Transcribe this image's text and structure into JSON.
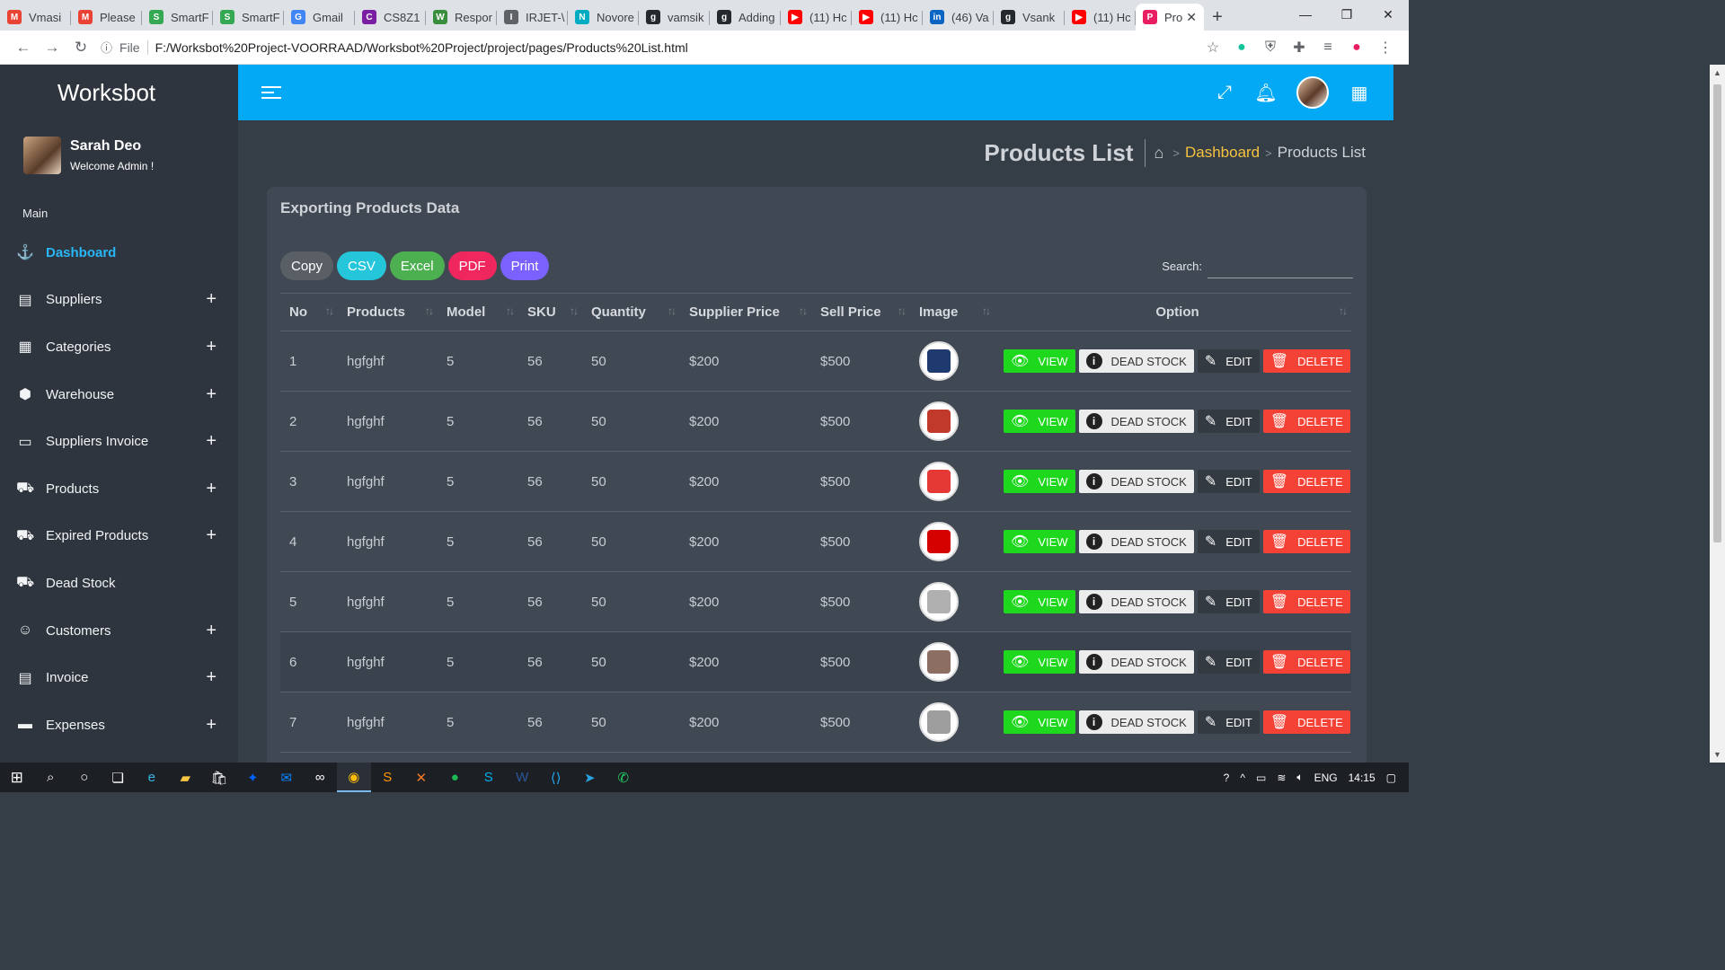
{
  "browser": {
    "tabs": [
      {
        "label": "Vmasi",
        "color": "#ea4335",
        "glyph": "M"
      },
      {
        "label": "Please",
        "color": "#ea4335",
        "glyph": "M"
      },
      {
        "label": "SmartF",
        "color": "#34a853",
        "glyph": "S"
      },
      {
        "label": "SmartF",
        "color": "#34a853",
        "glyph": "S"
      },
      {
        "label": "Gmail",
        "color": "#4285f4",
        "glyph": "G"
      },
      {
        "label": "CS8Z1",
        "color": "#7b1fa2",
        "glyph": "C"
      },
      {
        "label": "Respor",
        "color": "#388e3c",
        "glyph": "W"
      },
      {
        "label": "IRJET-\\",
        "color": "#5f6368",
        "glyph": "I"
      },
      {
        "label": "Novore",
        "color": "#00acc1",
        "glyph": "N"
      },
      {
        "label": "vamsik",
        "color": "#24292e",
        "glyph": "g"
      },
      {
        "label": "Adding",
        "color": "#24292e",
        "glyph": "g"
      },
      {
        "label": "(11) Hc",
        "color": "#ff0000",
        "glyph": "▶"
      },
      {
        "label": "(11) Hc",
        "color": "#ff0000",
        "glyph": "▶"
      },
      {
        "label": "(46) Va",
        "color": "#0a66c2",
        "glyph": "in"
      },
      {
        "label": "Vsank",
        "color": "#24292e",
        "glyph": "g"
      },
      {
        "label": "(11) Hc",
        "color": "#ff0000",
        "glyph": "▶"
      }
    ],
    "active_tab": {
      "label": "Pro",
      "color": "#e91e63",
      "glyph": "P"
    },
    "url_prefix": "File",
    "url": "F:/Worksbot%20Project-VOORRAAD/Worksbot%20Project/project/pages/Products%20List.html"
  },
  "sidebar": {
    "brand": "Worksbot",
    "user_name": "Sarah Deo",
    "user_role": "Welcome Admin !",
    "section": "Main",
    "items": [
      {
        "label": "Dashboard",
        "icon": "⚓",
        "active": true,
        "expand": ""
      },
      {
        "label": "Suppliers",
        "icon": "▤",
        "active": false,
        "expand": "+"
      },
      {
        "label": "Categories",
        "icon": "▦",
        "active": false,
        "expand": "+"
      },
      {
        "label": "Warehouse",
        "icon": "⬢",
        "active": false,
        "expand": "+"
      },
      {
        "label": "Suppliers Invoice",
        "icon": "▭",
        "active": false,
        "expand": "+"
      },
      {
        "label": "Products",
        "icon": "⛟",
        "active": false,
        "expand": "+"
      },
      {
        "label": "Expired Products",
        "icon": "⛟",
        "active": false,
        "expand": "+"
      },
      {
        "label": "Dead Stock",
        "icon": "⛟",
        "active": false,
        "expand": ""
      },
      {
        "label": "Customers",
        "icon": "☺",
        "active": false,
        "expand": "+"
      },
      {
        "label": "Invoice",
        "icon": "▤",
        "active": false,
        "expand": "+"
      },
      {
        "label": "Expenses",
        "icon": "▬",
        "active": false,
        "expand": "+"
      }
    ]
  },
  "page": {
    "title": "Products List",
    "breadcrumb_dashboard": "Dashboard",
    "breadcrumb_current": "Products List"
  },
  "card": {
    "title": "Exporting Products Data",
    "buttons": [
      {
        "label": "Copy",
        "color": "#5a5f66"
      },
      {
        "label": "CSV",
        "color": "#26c6da"
      },
      {
        "label": "Excel",
        "color": "#4caf50"
      },
      {
        "label": "PDF",
        "color": "#f0265e"
      },
      {
        "label": "Print",
        "color": "#7b61ff"
      }
    ],
    "search_label": "Search:",
    "search_value": ""
  },
  "table": {
    "columns": [
      "No",
      "Products",
      "Model",
      "SKU",
      "Quantity",
      "Supplier Price",
      "Sell Price",
      "Image",
      "Option"
    ],
    "rows": [
      {
        "no": "1",
        "product": "hgfghf",
        "model": "5",
        "sku": "56",
        "qty": "50",
        "supplier_price": "$200",
        "sell_price": "$500",
        "image_color": "#1e3a6e"
      },
      {
        "no": "2",
        "product": "hgfghf",
        "model": "5",
        "sku": "56",
        "qty": "50",
        "supplier_price": "$200",
        "sell_price": "$500",
        "image_color": "#c0392b"
      },
      {
        "no": "3",
        "product": "hgfghf",
        "model": "5",
        "sku": "56",
        "qty": "50",
        "supplier_price": "$200",
        "sell_price": "$500",
        "image_color": "#e53935"
      },
      {
        "no": "4",
        "product": "hgfghf",
        "model": "5",
        "sku": "56",
        "qty": "50",
        "supplier_price": "$200",
        "sell_price": "$500",
        "image_color": "#d50000"
      },
      {
        "no": "5",
        "product": "hgfghf",
        "model": "5",
        "sku": "56",
        "qty": "50",
        "supplier_price": "$200",
        "sell_price": "$500",
        "image_color": "#b0b0b0"
      },
      {
        "no": "6",
        "product": "hgfghf",
        "model": "5",
        "sku": "56",
        "qty": "50",
        "supplier_price": "$200",
        "sell_price": "$500",
        "image_color": "#8d6e63"
      },
      {
        "no": "7",
        "product": "hgfghf",
        "model": "5",
        "sku": "56",
        "qty": "50",
        "supplier_price": "$200",
        "sell_price": "$500",
        "image_color": "#9e9e9e"
      }
    ],
    "actions": {
      "view": "VIEW",
      "dead": "DEAD STOCK",
      "edit": "EDIT",
      "delete": "DELETE"
    }
  },
  "taskbar": {
    "language": "ENG",
    "time": "14:15"
  }
}
